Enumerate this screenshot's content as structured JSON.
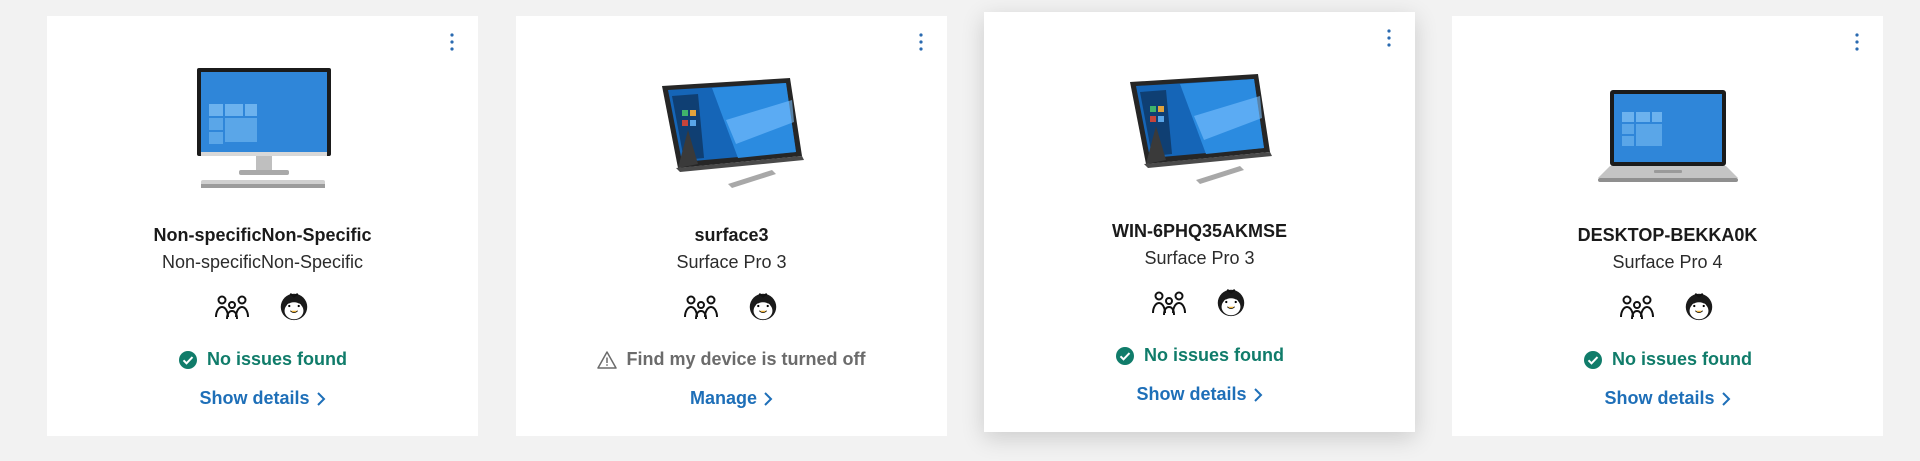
{
  "colors": {
    "page_bg": "#f2f2f2",
    "card_bg": "#ffffff",
    "ok_green": "#107c6a",
    "link_blue": "#1e6fb8",
    "warn_gray": "#6b6b6b",
    "more_blue": "#2a6ab0"
  },
  "devices": [
    {
      "name": "Non-specificNon-Specific",
      "model": "Non-specificNon-Specific",
      "image": "desktop-monitor-icon",
      "status_type": "ok",
      "status_icon": "check-circle-icon",
      "status_text": "No issues found",
      "action": "Show details",
      "action_icon": "chevron-right-icon",
      "more_icon": "more-vertical-icon",
      "user_icons": [
        "family-icon",
        "penguin-avatar-icon"
      ]
    },
    {
      "name": "surface3",
      "model": "Surface Pro 3",
      "image": "surface-tablet-icon",
      "status_type": "warn",
      "status_icon": "warning-triangle-icon",
      "status_text": "Find my device is turned off",
      "action": "Manage",
      "action_icon": "chevron-right-icon",
      "more_icon": "more-vertical-icon",
      "user_icons": [
        "family-icon",
        "penguin-avatar-icon"
      ]
    },
    {
      "name": "WIN-6PHQ35AKMSE",
      "model": "Surface Pro 3",
      "image": "surface-tablet-icon",
      "status_type": "ok",
      "status_icon": "check-circle-icon",
      "status_text": "No issues found",
      "action": "Show details",
      "action_icon": "chevron-right-icon",
      "more_icon": "more-vertical-icon",
      "user_icons": [
        "family-icon",
        "penguin-avatar-icon"
      ]
    },
    {
      "name": "DESKTOP-BEKKA0K",
      "model": "Surface Pro 4",
      "image": "laptop-icon",
      "status_type": "ok",
      "status_icon": "check-circle-icon",
      "status_text": "No issues found",
      "action": "Show details",
      "action_icon": "chevron-right-icon",
      "more_icon": "more-vertical-icon",
      "user_icons": [
        "family-icon",
        "penguin-avatar-icon"
      ]
    }
  ]
}
